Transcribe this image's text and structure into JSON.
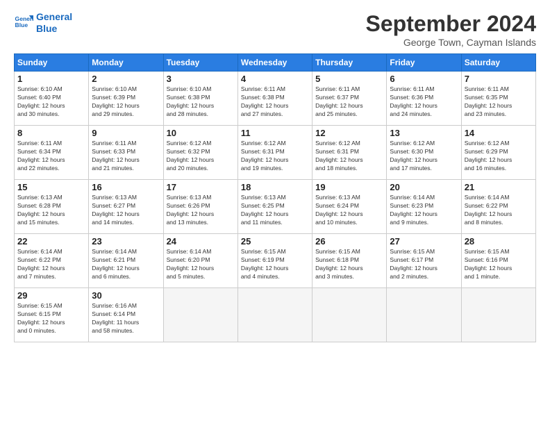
{
  "logo": {
    "line1": "General",
    "line2": "Blue"
  },
  "title": "September 2024",
  "location": "George Town, Cayman Islands",
  "days_header": [
    "Sunday",
    "Monday",
    "Tuesday",
    "Wednesday",
    "Thursday",
    "Friday",
    "Saturday"
  ],
  "weeks": [
    [
      {
        "num": "1",
        "lines": [
          "Sunrise: 6:10 AM",
          "Sunset: 6:40 PM",
          "Daylight: 12 hours",
          "and 30 minutes."
        ]
      },
      {
        "num": "2",
        "lines": [
          "Sunrise: 6:10 AM",
          "Sunset: 6:39 PM",
          "Daylight: 12 hours",
          "and 29 minutes."
        ]
      },
      {
        "num": "3",
        "lines": [
          "Sunrise: 6:10 AM",
          "Sunset: 6:38 PM",
          "Daylight: 12 hours",
          "and 28 minutes."
        ]
      },
      {
        "num": "4",
        "lines": [
          "Sunrise: 6:11 AM",
          "Sunset: 6:38 PM",
          "Daylight: 12 hours",
          "and 27 minutes."
        ]
      },
      {
        "num": "5",
        "lines": [
          "Sunrise: 6:11 AM",
          "Sunset: 6:37 PM",
          "Daylight: 12 hours",
          "and 25 minutes."
        ]
      },
      {
        "num": "6",
        "lines": [
          "Sunrise: 6:11 AM",
          "Sunset: 6:36 PM",
          "Daylight: 12 hours",
          "and 24 minutes."
        ]
      },
      {
        "num": "7",
        "lines": [
          "Sunrise: 6:11 AM",
          "Sunset: 6:35 PM",
          "Daylight: 12 hours",
          "and 23 minutes."
        ]
      }
    ],
    [
      {
        "num": "8",
        "lines": [
          "Sunrise: 6:11 AM",
          "Sunset: 6:34 PM",
          "Daylight: 12 hours",
          "and 22 minutes."
        ]
      },
      {
        "num": "9",
        "lines": [
          "Sunrise: 6:11 AM",
          "Sunset: 6:33 PM",
          "Daylight: 12 hours",
          "and 21 minutes."
        ]
      },
      {
        "num": "10",
        "lines": [
          "Sunrise: 6:12 AM",
          "Sunset: 6:32 PM",
          "Daylight: 12 hours",
          "and 20 minutes."
        ]
      },
      {
        "num": "11",
        "lines": [
          "Sunrise: 6:12 AM",
          "Sunset: 6:31 PM",
          "Daylight: 12 hours",
          "and 19 minutes."
        ]
      },
      {
        "num": "12",
        "lines": [
          "Sunrise: 6:12 AM",
          "Sunset: 6:31 PM",
          "Daylight: 12 hours",
          "and 18 minutes."
        ]
      },
      {
        "num": "13",
        "lines": [
          "Sunrise: 6:12 AM",
          "Sunset: 6:30 PM",
          "Daylight: 12 hours",
          "and 17 minutes."
        ]
      },
      {
        "num": "14",
        "lines": [
          "Sunrise: 6:12 AM",
          "Sunset: 6:29 PM",
          "Daylight: 12 hours",
          "and 16 minutes."
        ]
      }
    ],
    [
      {
        "num": "15",
        "lines": [
          "Sunrise: 6:13 AM",
          "Sunset: 6:28 PM",
          "Daylight: 12 hours",
          "and 15 minutes."
        ]
      },
      {
        "num": "16",
        "lines": [
          "Sunrise: 6:13 AM",
          "Sunset: 6:27 PM",
          "Daylight: 12 hours",
          "and 14 minutes."
        ]
      },
      {
        "num": "17",
        "lines": [
          "Sunrise: 6:13 AM",
          "Sunset: 6:26 PM",
          "Daylight: 12 hours",
          "and 13 minutes."
        ]
      },
      {
        "num": "18",
        "lines": [
          "Sunrise: 6:13 AM",
          "Sunset: 6:25 PM",
          "Daylight: 12 hours",
          "and 11 minutes."
        ]
      },
      {
        "num": "19",
        "lines": [
          "Sunrise: 6:13 AM",
          "Sunset: 6:24 PM",
          "Daylight: 12 hours",
          "and 10 minutes."
        ]
      },
      {
        "num": "20",
        "lines": [
          "Sunrise: 6:14 AM",
          "Sunset: 6:23 PM",
          "Daylight: 12 hours",
          "and 9 minutes."
        ]
      },
      {
        "num": "21",
        "lines": [
          "Sunrise: 6:14 AM",
          "Sunset: 6:22 PM",
          "Daylight: 12 hours",
          "and 8 minutes."
        ]
      }
    ],
    [
      {
        "num": "22",
        "lines": [
          "Sunrise: 6:14 AM",
          "Sunset: 6:22 PM",
          "Daylight: 12 hours",
          "and 7 minutes."
        ]
      },
      {
        "num": "23",
        "lines": [
          "Sunrise: 6:14 AM",
          "Sunset: 6:21 PM",
          "Daylight: 12 hours",
          "and 6 minutes."
        ]
      },
      {
        "num": "24",
        "lines": [
          "Sunrise: 6:14 AM",
          "Sunset: 6:20 PM",
          "Daylight: 12 hours",
          "and 5 minutes."
        ]
      },
      {
        "num": "25",
        "lines": [
          "Sunrise: 6:15 AM",
          "Sunset: 6:19 PM",
          "Daylight: 12 hours",
          "and 4 minutes."
        ]
      },
      {
        "num": "26",
        "lines": [
          "Sunrise: 6:15 AM",
          "Sunset: 6:18 PM",
          "Daylight: 12 hours",
          "and 3 minutes."
        ]
      },
      {
        "num": "27",
        "lines": [
          "Sunrise: 6:15 AM",
          "Sunset: 6:17 PM",
          "Daylight: 12 hours",
          "and 2 minutes."
        ]
      },
      {
        "num": "28",
        "lines": [
          "Sunrise: 6:15 AM",
          "Sunset: 6:16 PM",
          "Daylight: 12 hours",
          "and 1 minute."
        ]
      }
    ],
    [
      {
        "num": "29",
        "lines": [
          "Sunrise: 6:15 AM",
          "Sunset: 6:15 PM",
          "Daylight: 12 hours",
          "and 0 minutes."
        ]
      },
      {
        "num": "30",
        "lines": [
          "Sunrise: 6:16 AM",
          "Sunset: 6:14 PM",
          "Daylight: 11 hours",
          "and 58 minutes."
        ]
      },
      null,
      null,
      null,
      null,
      null
    ]
  ]
}
